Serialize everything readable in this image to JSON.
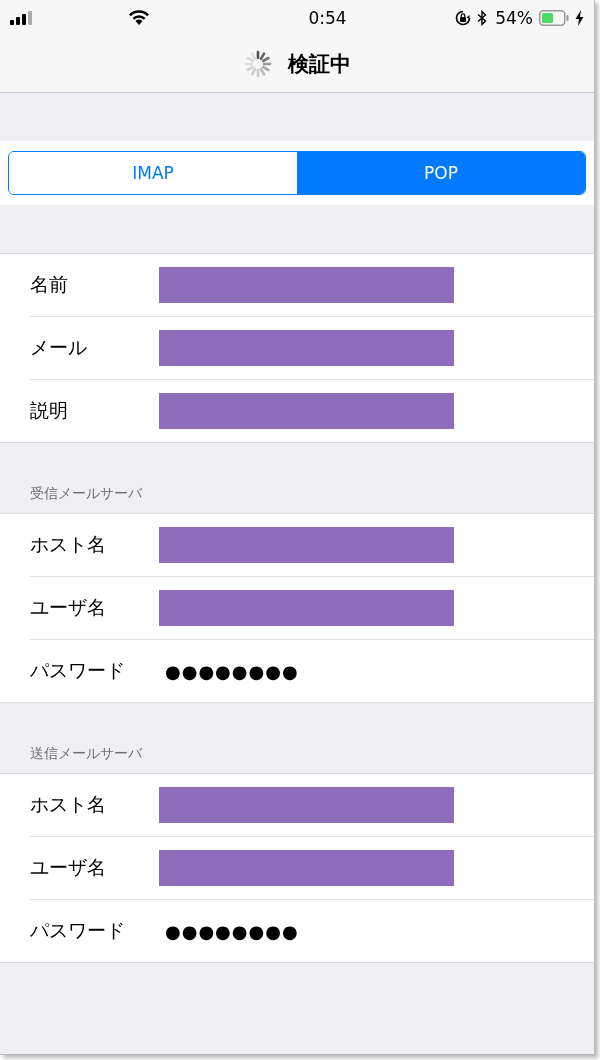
{
  "status_bar": {
    "time": "0:54",
    "battery": "54%"
  },
  "nav": {
    "title": "検証中",
    "loading": true
  },
  "segments": [
    {
      "label": "IMAP",
      "selected": false
    },
    {
      "label": "POP",
      "selected": true
    }
  ],
  "sections": [
    {
      "rows": [
        {
          "label": "名前",
          "kind": "redacted"
        },
        {
          "label": "メール",
          "kind": "redacted"
        },
        {
          "label": "説明",
          "kind": "redacted"
        }
      ]
    },
    {
      "header": "受信メールサーバ",
      "rows": [
        {
          "label": "ホスト名",
          "kind": "redacted"
        },
        {
          "label": "ユーザ名",
          "kind": "redacted"
        },
        {
          "label": "パスワード",
          "kind": "password",
          "value": "●●●●●●●●"
        }
      ]
    },
    {
      "header": "送信メールサーバ",
      "rows": [
        {
          "label": "ホスト名",
          "kind": "redacted"
        },
        {
          "label": "ユーザ名",
          "kind": "redacted"
        },
        {
          "label": "パスワード",
          "kind": "password",
          "value": "●●●●●●●●"
        }
      ]
    }
  ]
}
